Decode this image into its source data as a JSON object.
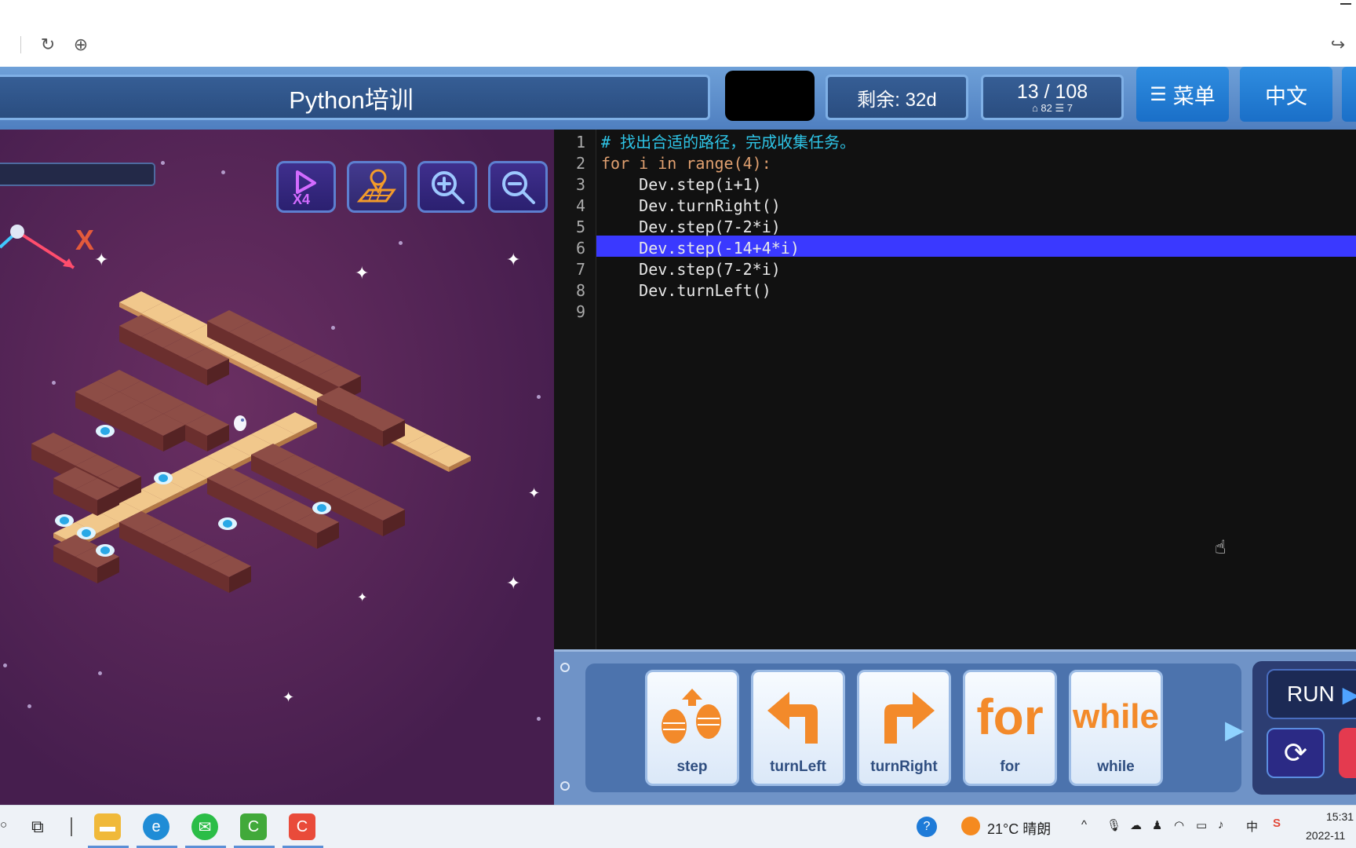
{
  "header": {
    "title": "Python培训",
    "remaining": "剩余: 32d",
    "progress": "13 / 108",
    "progress_stats": "⌂ 82   ☰ 7",
    "menu_label": "菜单",
    "lang_label": "中文"
  },
  "game": {
    "axis_label": "X",
    "speed_label": "X4",
    "controls": [
      "play-speed-icon",
      "map-pin-icon",
      "zoom-in-icon",
      "zoom-out-icon"
    ]
  },
  "editor": {
    "lines": [
      {
        "num": "1",
        "text": "# 找出合适的路径，完成收集任务。"
      },
      {
        "num": "2",
        "text": "for i in range(4):"
      },
      {
        "num": "3",
        "text": "    Dev.step(i+1)"
      },
      {
        "num": "4",
        "text": "    Dev.turnRight()"
      },
      {
        "num": "5",
        "text": "    Dev.step(7-2*i)"
      },
      {
        "num": "6",
        "text": "    Dev.step(-14+4*i)"
      },
      {
        "num": "7",
        "text": "    Dev.step(7-2*i)"
      },
      {
        "num": "8",
        "text": "    Dev.turnLeft()"
      },
      {
        "num": "9",
        "text": ""
      }
    ],
    "highlighted_line": "6"
  },
  "blocks": [
    {
      "label": "step",
      "icon": "step-feet-icon"
    },
    {
      "label": "turnLeft",
      "icon": "turn-left-arrow-icon"
    },
    {
      "label": "turnRight",
      "icon": "turn-right-arrow-icon"
    },
    {
      "label": "for",
      "art": "for"
    },
    {
      "label": "while",
      "art": "while"
    }
  ],
  "run": {
    "run_label": "RUN"
  },
  "taskbar": {
    "weather": "21°C 晴朗",
    "ime": "中",
    "time": "15:31",
    "date": "2022-11"
  },
  "colors": {
    "highlight": "#3a39ff",
    "header_blue": "#4f7fc0",
    "game_bg": "#461e4e"
  }
}
